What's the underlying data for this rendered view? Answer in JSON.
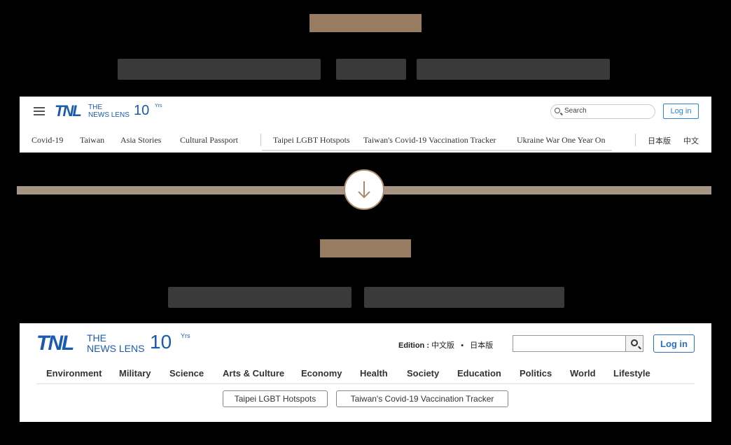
{
  "before_header": {
    "logo": {
      "mark": "TNL",
      "line1": "THE",
      "line2": "NEWS LENS",
      "anniv": "10",
      "anniv_suffix": "Yrs"
    },
    "search_placeholder": "Search",
    "login_label": "Log in",
    "nav_main": [
      "Covid-19",
      "Taiwan",
      "Asia Stories",
      "Cultural Passport"
    ],
    "nav_topics": [
      "Taipei LGBT Hotspots",
      "Taiwan's Covid-19 Vaccination Tracker",
      "Ukraine War One Year On"
    ],
    "nav_editions": [
      "日本版",
      "中文"
    ]
  },
  "after_header": {
    "logo": {
      "mark": "TNL",
      "line1": "THE",
      "line2": "NEWS LENS",
      "anniv": "10",
      "anniv_suffix": "Yrs"
    },
    "edition_label": "Edition :",
    "edition_zh": "中文版",
    "edition_dot": "•",
    "edition_jp": "日本版",
    "login_label": "Log in",
    "nav": [
      "Environment",
      "Military",
      "Science",
      "Arts & Culture",
      "Economy",
      "Health",
      "Society",
      "Education",
      "Politics",
      "World",
      "Lifestyle"
    ],
    "topic_pills": [
      "Taipei LGBT Hotspots",
      "Taiwan's Covid-19 Vaccination Tracker"
    ]
  },
  "colors": {
    "accent_gold": "#b39272",
    "brand_blue": "#1a5bb0",
    "link_blue": "#2b84d6",
    "divider": "#a49584"
  },
  "icons": {
    "divider_arrow": "arrow-down-icon",
    "search": "search-icon",
    "menu": "hamburger-menu-icon"
  }
}
